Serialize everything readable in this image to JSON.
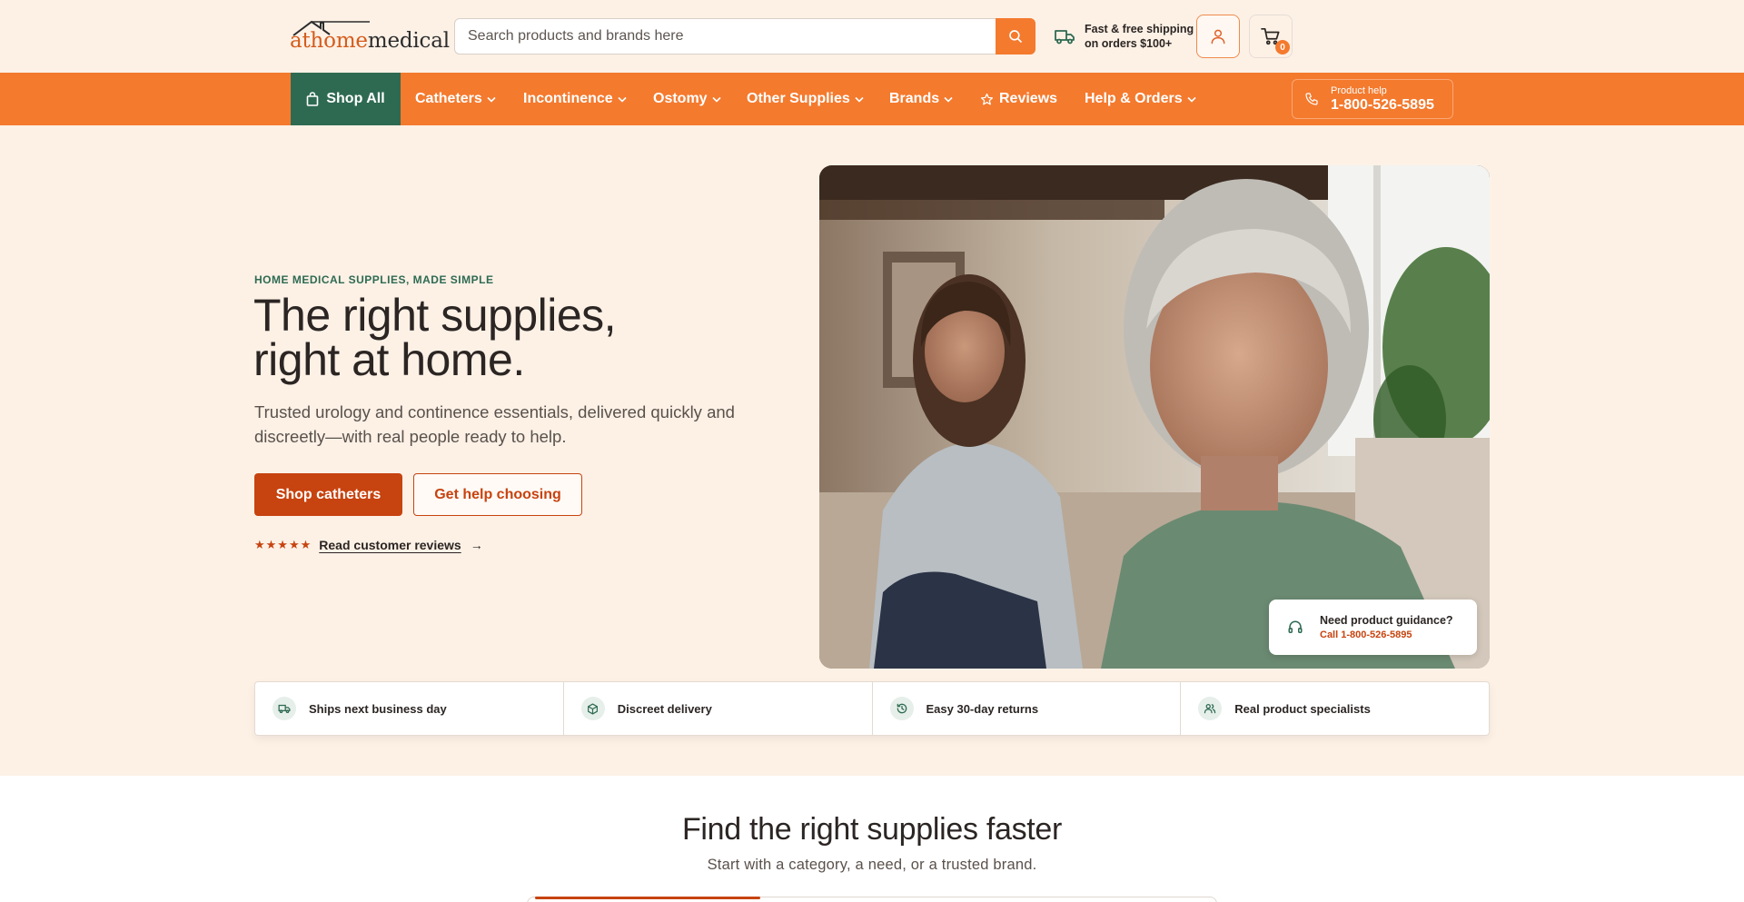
{
  "header": {
    "logo": {
      "part1": "athome",
      "part2": "medical"
    },
    "search": {
      "placeholder": "Search products and brands here",
      "value": ""
    },
    "shipping": {
      "line1": "Fast & free shipping",
      "line2": "on orders $100+"
    },
    "cart": {
      "count": "0"
    },
    "icons": {
      "search": "search-icon",
      "truck": "truck-icon",
      "account": "user-icon",
      "cart": "cart-icon"
    }
  },
  "nav": {
    "shop_all": "Shop All",
    "items": [
      {
        "label": "Catheters",
        "dropdown": true
      },
      {
        "label": "Incontinence",
        "dropdown": true
      },
      {
        "label": "Ostomy",
        "dropdown": true
      },
      {
        "label": "Other Supplies",
        "dropdown": true
      },
      {
        "label": "Brands",
        "dropdown": true
      },
      {
        "label": "Reviews",
        "dropdown": false,
        "icon": "star-icon"
      },
      {
        "label": "Help & Orders",
        "dropdown": true
      }
    ],
    "phone": {
      "label": "Product help",
      "number": "1-800-526-5895"
    }
  },
  "hero": {
    "eyebrow": "HOME MEDICAL SUPPLIES, MADE SIMPLE",
    "headline_line1": "The right supplies,",
    "headline_line2": "right at home.",
    "subcopy": "Trusted urology and continence essentials, delivered quickly and discreetly—with real people ready to help.",
    "primary_cta": "Shop catheters",
    "secondary_cta": "Get help choosing",
    "stars": "★★★★★",
    "reviews_link": "Read customer reviews",
    "reviews_arrow": "→",
    "guidance": {
      "title": "Need product guidance?",
      "subtitle": "Call 1-800-526-5895"
    }
  },
  "features": [
    {
      "label": "Ships next business day",
      "icon": "truck-icon"
    },
    {
      "label": "Discreet delivery",
      "icon": "box-icon"
    },
    {
      "label": "Easy 30-day returns",
      "icon": "history-icon"
    },
    {
      "label": "Real product specialists",
      "icon": "users-icon"
    }
  ],
  "finder": {
    "title": "Find the right supplies faster",
    "subtitle": "Start with a category, a need, or a trusted brand."
  },
  "colors": {
    "brand_orange": "#f47a2e",
    "cta_orange": "#c7430f",
    "brand_green": "#2e6a52",
    "page_cream": "#fdf1e6"
  }
}
